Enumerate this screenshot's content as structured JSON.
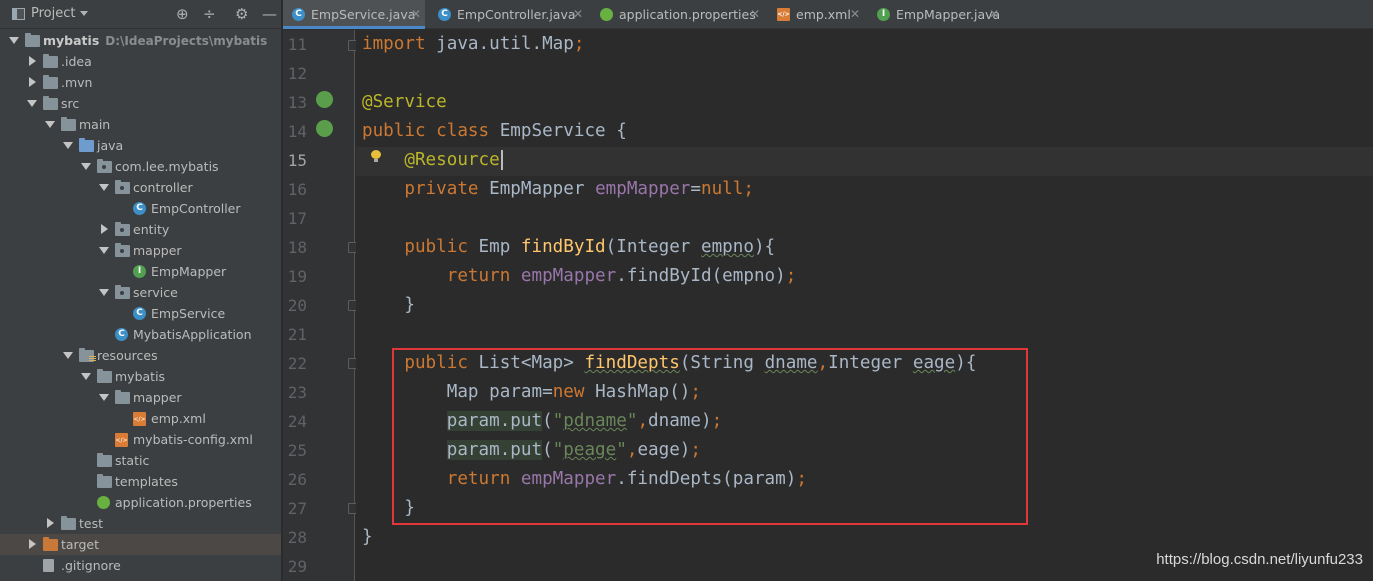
{
  "panel": {
    "title": "Project",
    "tools": [
      "target-icon",
      "collapse-icon",
      "gear-icon",
      "minimize-icon"
    ]
  },
  "tree": [
    {
      "label": "mybatis",
      "path": "D:\\IdeaProjects\\mybatis",
      "depth": 0,
      "arrow": "down",
      "icon": "folder",
      "bold": true
    },
    {
      "label": ".idea",
      "depth": 1,
      "arrow": "right",
      "icon": "folder"
    },
    {
      "label": ".mvn",
      "depth": 1,
      "arrow": "right",
      "icon": "folder"
    },
    {
      "label": "src",
      "depth": 1,
      "arrow": "down",
      "icon": "folder"
    },
    {
      "label": "main",
      "depth": 2,
      "arrow": "down",
      "icon": "folder"
    },
    {
      "label": "java",
      "depth": 3,
      "arrow": "down",
      "icon": "folder-blue"
    },
    {
      "label": "com.lee.mybatis",
      "depth": 4,
      "arrow": "down",
      "icon": "package"
    },
    {
      "label": "controller",
      "depth": 5,
      "arrow": "down",
      "icon": "package"
    },
    {
      "label": "EmpController",
      "depth": 6,
      "arrow": "",
      "icon": "class"
    },
    {
      "label": "entity",
      "depth": 5,
      "arrow": "right",
      "icon": "package"
    },
    {
      "label": "mapper",
      "depth": 5,
      "arrow": "down",
      "icon": "package"
    },
    {
      "label": "EmpMapper",
      "depth": 6,
      "arrow": "",
      "icon": "interface"
    },
    {
      "label": "service",
      "depth": 5,
      "arrow": "down",
      "icon": "package"
    },
    {
      "label": "EmpService",
      "depth": 6,
      "arrow": "",
      "icon": "class"
    },
    {
      "label": "MybatisApplication",
      "depth": 5,
      "arrow": "",
      "icon": "class-spring"
    },
    {
      "label": "resources",
      "depth": 3,
      "arrow": "down",
      "icon": "folder-resources"
    },
    {
      "label": "mybatis",
      "depth": 4,
      "arrow": "down",
      "icon": "folder"
    },
    {
      "label": "mapper",
      "depth": 5,
      "arrow": "down",
      "icon": "folder"
    },
    {
      "label": "emp.xml",
      "depth": 6,
      "arrow": "",
      "icon": "xml"
    },
    {
      "label": "mybatis-config.xml",
      "depth": 5,
      "arrow": "",
      "icon": "xml"
    },
    {
      "label": "static",
      "depth": 4,
      "arrow": "",
      "icon": "folder"
    },
    {
      "label": "templates",
      "depth": 4,
      "arrow": "",
      "icon": "folder"
    },
    {
      "label": "application.properties",
      "depth": 4,
      "arrow": "",
      "icon": "spring"
    },
    {
      "label": "test",
      "depth": 2,
      "arrow": "right",
      "icon": "folder"
    },
    {
      "label": "target",
      "depth": 1,
      "arrow": "right",
      "icon": "folder-orange",
      "selected": true
    },
    {
      "label": ".gitignore",
      "depth": 1,
      "arrow": "",
      "icon": "file"
    }
  ],
  "tabs": [
    {
      "label": "EmpService.java",
      "icon": "class",
      "active": true
    },
    {
      "label": "EmpController.java",
      "icon": "class"
    },
    {
      "label": "application.properties",
      "icon": "spring"
    },
    {
      "label": "emp.xml",
      "icon": "xml"
    },
    {
      "label": "EmpMapper.java",
      "icon": "interface"
    }
  ],
  "editor": {
    "line_numbers": [
      "11",
      "12",
      "13",
      "14",
      "15",
      "16",
      "17",
      "18",
      "19",
      "20",
      "21",
      "22",
      "23",
      "24",
      "25",
      "26",
      "27",
      "28",
      "29"
    ],
    "current_line": "15",
    "lines": [
      [
        {
          "t": "import ",
          "c": "kw"
        },
        {
          "t": "java.util.Map",
          "c": ""
        },
        {
          "t": ";",
          "c": "kw"
        }
      ],
      [],
      [
        {
          "t": "@Service",
          "c": "ann"
        }
      ],
      [
        {
          "t": "public class ",
          "c": "kw"
        },
        {
          "t": "EmpService {",
          "c": ""
        }
      ],
      [
        {
          "t": "    ",
          "c": ""
        },
        {
          "t": "@Resource",
          "c": "ann"
        }
      ],
      [
        {
          "t": "    ",
          "c": ""
        },
        {
          "t": "private ",
          "c": "kw"
        },
        {
          "t": "EmpMapper ",
          "c": ""
        },
        {
          "t": "empMapper",
          "c": "fld"
        },
        {
          "t": "=",
          "c": ""
        },
        {
          "t": "null",
          "c": "kw"
        },
        {
          "t": ";",
          "c": "kw"
        }
      ],
      [],
      [
        {
          "t": "    ",
          "c": ""
        },
        {
          "t": "public ",
          "c": "kw"
        },
        {
          "t": "Emp ",
          "c": ""
        },
        {
          "t": "findById",
          "c": "fn"
        },
        {
          "t": "(Integer ",
          "c": ""
        },
        {
          "t": "empno",
          "c": "sq"
        },
        {
          "t": "){",
          "c": ""
        }
      ],
      [
        {
          "t": "        ",
          "c": ""
        },
        {
          "t": "return ",
          "c": "kw"
        },
        {
          "t": "empMapper",
          "c": "fld"
        },
        {
          "t": ".findById(empno)",
          "c": ""
        },
        {
          "t": ";",
          "c": "kw"
        }
      ],
      [
        {
          "t": "    }",
          "c": ""
        }
      ],
      [],
      [
        {
          "t": "    ",
          "c": ""
        },
        {
          "t": "public ",
          "c": "kw"
        },
        {
          "t": "List<Map> ",
          "c": ""
        },
        {
          "t": "findDepts",
          "c": "fn sq"
        },
        {
          "t": "(String ",
          "c": ""
        },
        {
          "t": "dname",
          "c": "sq"
        },
        {
          "t": ",",
          "c": "kw"
        },
        {
          "t": "Integer ",
          "c": ""
        },
        {
          "t": "eage",
          "c": "sq"
        },
        {
          "t": "){",
          "c": ""
        }
      ],
      [
        {
          "t": "        ",
          "c": ""
        },
        {
          "t": "Map param=",
          "c": ""
        },
        {
          "t": "new ",
          "c": "kw"
        },
        {
          "t": "HashMap()",
          "c": ""
        },
        {
          "t": ";",
          "c": "kw"
        }
      ],
      [
        {
          "t": "        ",
          "c": ""
        },
        {
          "t": "param.put",
          "c": "hl"
        },
        {
          "t": "(",
          "c": ""
        },
        {
          "t": "\"",
          "c": "str"
        },
        {
          "t": "pdname",
          "c": "str sq"
        },
        {
          "t": "\"",
          "c": "str"
        },
        {
          "t": ",",
          "c": "kw"
        },
        {
          "t": "dname)",
          "c": ""
        },
        {
          "t": ";",
          "c": "kw"
        }
      ],
      [
        {
          "t": "        ",
          "c": ""
        },
        {
          "t": "param.put",
          "c": "hl"
        },
        {
          "t": "(",
          "c": ""
        },
        {
          "t": "\"",
          "c": "str"
        },
        {
          "t": "peage",
          "c": "str sq"
        },
        {
          "t": "\"",
          "c": "str"
        },
        {
          "t": ",",
          "c": "kw"
        },
        {
          "t": "eage)",
          "c": ""
        },
        {
          "t": ";",
          "c": "kw"
        }
      ],
      [
        {
          "t": "        ",
          "c": ""
        },
        {
          "t": "return ",
          "c": "kw"
        },
        {
          "t": "empMapper",
          "c": "fld"
        },
        {
          "t": ".findDepts(param)",
          "c": ""
        },
        {
          "t": ";",
          "c": "kw"
        }
      ],
      [
        {
          "t": "    }",
          "c": ""
        }
      ],
      [
        {
          "t": "}",
          "c": ""
        }
      ],
      []
    ]
  },
  "watermark": "https://blog.csdn.net/liyunfu233",
  "colors": {
    "keyword": "#cc7832",
    "annotation": "#bbb529",
    "method": "#ffc66d",
    "field": "#9876aa",
    "string": "#6a8759",
    "highlight_box": "#e0383a"
  }
}
